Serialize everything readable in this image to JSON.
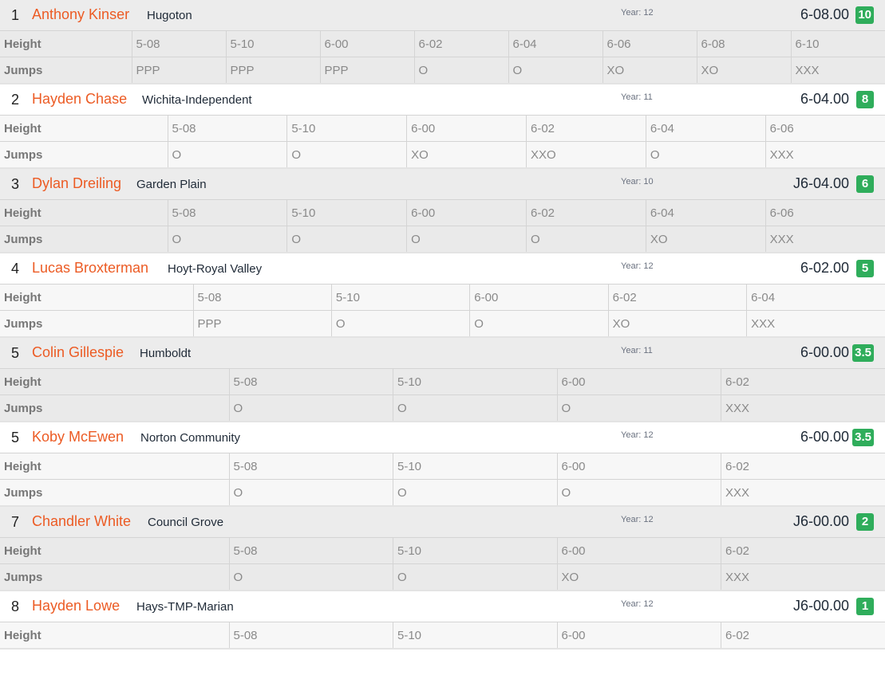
{
  "labels": {
    "height": "Height",
    "jumps": "Jumps"
  },
  "colors": {
    "name": "#ec5b24",
    "points_badge": "#2fad5b"
  },
  "athletes": [
    {
      "place": "1",
      "name": "Anthony Kinser",
      "school": "Hugoton",
      "year": "Year: 12",
      "mark": "6-08.00",
      "points": "10",
      "heights": [
        "5-08",
        "5-10",
        "6-00",
        "6-02",
        "6-04",
        "6-06",
        "6-08",
        "6-10"
      ],
      "jumps": [
        "PPP",
        "PPP",
        "PPP",
        "O",
        "O",
        "XO",
        "XO",
        "XXX"
      ]
    },
    {
      "place": "2",
      "name": "Hayden Chase",
      "school": "Wichita-Independent",
      "year": "Year: 11",
      "mark": "6-04.00",
      "points": "8",
      "heights": [
        "5-08",
        "5-10",
        "6-00",
        "6-02",
        "6-04",
        "6-06"
      ],
      "jumps": [
        "O",
        "O",
        "XO",
        "XXO",
        "O",
        "XXX"
      ]
    },
    {
      "place": "3",
      "name": "Dylan Dreiling",
      "school": "Garden Plain",
      "year": "Year: 10",
      "mark": "J6-04.00",
      "points": "6",
      "heights": [
        "5-08",
        "5-10",
        "6-00",
        "6-02",
        "6-04",
        "6-06"
      ],
      "jumps": [
        "O",
        "O",
        "O",
        "O",
        "XO",
        "XXX"
      ]
    },
    {
      "place": "4",
      "name": "Lucas Broxterman",
      "school": "Hoyt-Royal Valley",
      "year": "Year: 12",
      "mark": "6-02.00",
      "points": "5",
      "heights": [
        "5-08",
        "5-10",
        "6-00",
        "6-02",
        "6-04"
      ],
      "jumps": [
        "PPP",
        "O",
        "O",
        "XO",
        "XXX"
      ]
    },
    {
      "place": "5",
      "name": "Colin Gillespie",
      "school": "Humboldt",
      "year": "Year: 11",
      "mark": "6-00.00",
      "points": "3.5",
      "heights": [
        "5-08",
        "5-10",
        "6-00",
        "6-02"
      ],
      "jumps": [
        "O",
        "O",
        "O",
        "XXX"
      ]
    },
    {
      "place": "5",
      "name": "Koby McEwen",
      "school": "Norton Community",
      "year": "Year: 12",
      "mark": "6-00.00",
      "points": "3.5",
      "heights": [
        "5-08",
        "5-10",
        "6-00",
        "6-02"
      ],
      "jumps": [
        "O",
        "O",
        "O",
        "XXX"
      ]
    },
    {
      "place": "7",
      "name": "Chandler White",
      "school": "Council Grove",
      "year": "Year: 12",
      "mark": "J6-00.00",
      "points": "2",
      "heights": [
        "5-08",
        "5-10",
        "6-00",
        "6-02"
      ],
      "jumps": [
        "O",
        "O",
        "XO",
        "XXX"
      ]
    },
    {
      "place": "8",
      "name": "Hayden Lowe",
      "school": "Hays-TMP-Marian",
      "year": "Year: 12",
      "mark": "J6-00.00",
      "points": "1",
      "heights": [
        "5-08",
        "5-10",
        "6-00",
        "6-02"
      ],
      "jumps": []
    }
  ]
}
